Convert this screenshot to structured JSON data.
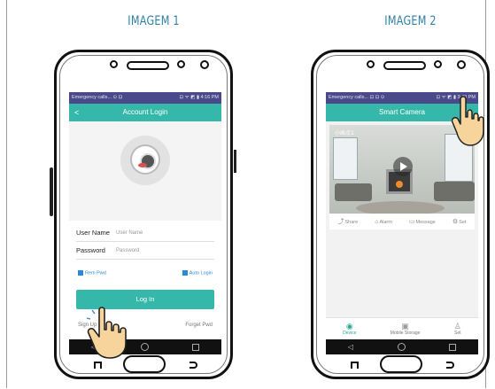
{
  "panels": [
    {
      "title": "IMAGEM 1",
      "statusbar": {
        "left": "Emergency calls... ⊙ ⊡",
        "right": "⊡ ᯤ ◩ ▮ 4:16 PM"
      },
      "appbar_title": "Account Login",
      "back_glyph": "<",
      "form": {
        "username_label": "User Name",
        "username_placeholder": "User Name",
        "password_label": "Password",
        "password_placeholder": "Password"
      },
      "options": {
        "remember": "Rem Pwd",
        "auto": "Auto Login"
      },
      "login_button": "Log In",
      "signup_link": "Sign Up",
      "forget_link": "Forget Pwd"
    },
    {
      "title": "IMAGEM 2",
      "statusbar": {
        "left": "Emergency calls... ⊡ ⊡ ⊙",
        "right": "⊡ ᯤ ◩ ▮ 3:40 PM"
      },
      "appbar_title": "Smart Camera",
      "camera_name": "小画点1",
      "actions": [
        {
          "icon": "share-icon",
          "label": "Share"
        },
        {
          "icon": "alarm-icon",
          "label": "Alarm"
        },
        {
          "icon": "message-icon",
          "label": "Message"
        },
        {
          "icon": "set-icon",
          "label": "Set"
        }
      ],
      "tabs": [
        {
          "icon": "device-icon",
          "label": "Device",
          "active": true
        },
        {
          "icon": "storage-icon",
          "label": "Mobile Storage",
          "active": false
        },
        {
          "icon": "person-icon",
          "label": "Set",
          "active": false
        }
      ]
    }
  ],
  "colors": {
    "accent": "#35b8a9",
    "title": "#2c7fa6",
    "status": "#4a4a8a",
    "link": "#2b8ad6"
  }
}
